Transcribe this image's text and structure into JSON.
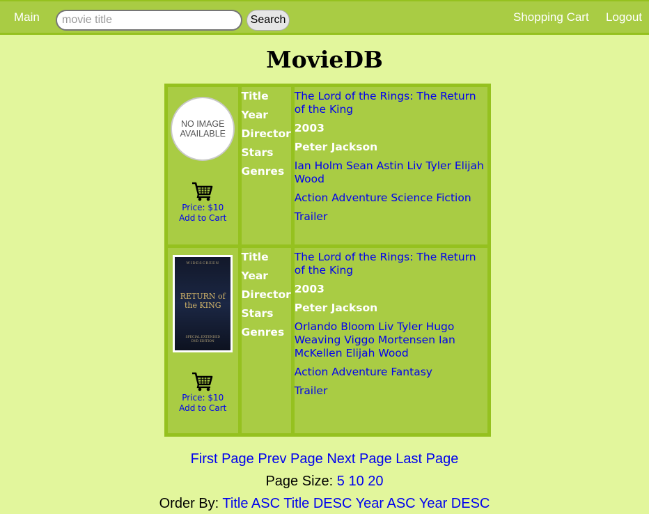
{
  "nav": {
    "main_label": "Main",
    "search_placeholder": "movie title",
    "search_button": "Search",
    "cart_label": "Shopping Cart",
    "logout_label": "Logout"
  },
  "page_title": "MovieDB",
  "field_labels": {
    "title": "Title",
    "year": "Year",
    "director": "Director",
    "stars": "Stars",
    "genres": "Genres"
  },
  "movies": [
    {
      "image_text_1": "NO IMAGE",
      "image_text_2": "AVAILABLE",
      "price": "Price: $10",
      "add_to_cart": "Add to Cart",
      "title": "The Lord of the Rings: The Return of the King",
      "year": "2003",
      "director": "Peter Jackson",
      "stars": "Ian Holm Sean Astin Liv Tyler Elijah Wood",
      "genres": "Action Adventure Science Fiction",
      "trailer": "Trailer"
    },
    {
      "price": "Price: $10",
      "add_to_cart": "Add to Cart",
      "title": "The Lord of the Rings: The Return of the King",
      "year": "2003",
      "director": "Peter Jackson",
      "stars": "Orlando Bloom Liv Tyler Hugo Weaving Viggo Mortensen Ian McKellen Elijah Wood",
      "genres": "Action Adventure Fantasy",
      "trailer": "Trailer"
    }
  ],
  "pagination": {
    "first": "First Page",
    "prev": "Prev Page",
    "next": "Next Page",
    "last": "Last Page"
  },
  "page_size": {
    "label": "Page Size:",
    "options": [
      "5",
      "10",
      "20"
    ]
  },
  "order_by": {
    "label": "Order By:",
    "options": [
      "Title ASC",
      "Title DESC",
      "Year ASC",
      "Year DESC"
    ]
  },
  "colors": {
    "background": "#e2f69c",
    "bar": "#a9cc44",
    "border": "#95c11f",
    "link": "#0000ee"
  },
  "icons": {
    "cart": "shopping-cart-icon"
  }
}
